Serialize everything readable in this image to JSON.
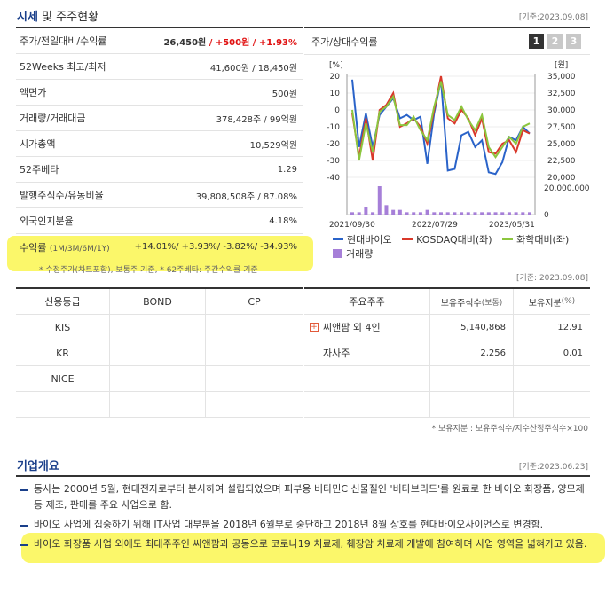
{
  "header": {
    "title_main": "시세",
    "title_rest": " 및 주주현황",
    "base_date": "[기준:2023.09.08]"
  },
  "summary": {
    "rows": [
      {
        "label": "주가/전일대비/수익률",
        "value_a": "26,450원",
        "value_b": " / +500원",
        "value_c": " / +1.93%"
      },
      {
        "label": "52Weeks 최고/최저",
        "value": "41,600원 / 18,450원"
      },
      {
        "label": "액면가",
        "value": "500원"
      },
      {
        "label": "거래량/거래대금",
        "value": "378,428주 / 99억원"
      },
      {
        "label": "시가총액",
        "value": "10,529억원"
      },
      {
        "label": "52주베타",
        "value": "1.29"
      },
      {
        "label": "발행주식수/유동비율",
        "value": "39,808,508주 / 87.08%"
      },
      {
        "label": "외국인지분율",
        "value": "4.18%"
      }
    ],
    "return_label": "수익률",
    "return_sub": "(1M/3M/6M/1Y)",
    "return_value": "+14.01%/ +3.93%/ -3.82%/ -34.93%",
    "note": "* 수정주가(차트포함), 보통주 기준, * 62주베타: 주간수익률 기준"
  },
  "chart_panel": {
    "title": "주가/상대수익률",
    "tabs": [
      "1",
      "2",
      "3"
    ],
    "active_tab": 0
  },
  "chart_data": {
    "type": "line",
    "left_axis_unit": "[%]",
    "right_axis_unit": "[원]",
    "left_ticks": [
      "20",
      "10",
      "0",
      "-10",
      "-20",
      "-30",
      "-40"
    ],
    "right_ticks": [
      "35,000",
      "32,500",
      "30,000",
      "27,500",
      "25,000",
      "22,500",
      "20,000"
    ],
    "volume_tick": "20,000,000",
    "volume_zero": "0",
    "x_labels": [
      "2021/09/30",
      "2022/07/29",
      "2023/05/31"
    ],
    "ylim_left": [
      -40,
      20
    ],
    "series": [
      {
        "name": "현대바이오",
        "color": "#2a63c9",
        "values": [
          18,
          -22,
          -2,
          -22,
          -3,
          2,
          7,
          -5,
          -3,
          -6,
          -4,
          -32,
          -2,
          18,
          -36,
          -35,
          -15,
          -13,
          -22,
          -18,
          -37,
          -38,
          -31,
          -16,
          -18,
          -10,
          -14
        ]
      },
      {
        "name": "KOSDAQ대비(좌)",
        "color": "#d9382a",
        "values": [
          -2,
          -28,
          -5,
          -30,
          0,
          3,
          10,
          -10,
          -8,
          -5,
          -10,
          -20,
          0,
          20,
          -5,
          -8,
          0,
          -5,
          -15,
          -5,
          -25,
          -26,
          -20,
          -18,
          -25,
          -12,
          -14
        ]
      },
      {
        "name": "화학대비(좌)",
        "color": "#8cc63e",
        "values": [
          0,
          -30,
          -8,
          -25,
          -1,
          2,
          8,
          -9,
          -9,
          -4,
          -12,
          -18,
          2,
          17,
          -3,
          -6,
          2,
          -6,
          -12,
          -3,
          -22,
          -28,
          -22,
          -16,
          -20,
          -10,
          -8
        ]
      }
    ],
    "volume": {
      "name": "거래량",
      "color": "#a67fd8",
      "values": [
        1,
        1,
        3,
        1,
        12,
        4,
        2,
        2,
        1,
        1,
        1,
        2,
        1,
        1,
        1,
        1,
        1,
        1,
        1,
        1,
        1,
        1,
        1,
        1,
        1,
        1,
        1
      ]
    }
  },
  "legend": [
    {
      "label": "현대바이오",
      "type": "line",
      "color": "#2a63c9"
    },
    {
      "label": "KOSDAQ대비(좌)",
      "type": "line",
      "color": "#d9382a"
    },
    {
      "label": "화학대비(좌)",
      "type": "line",
      "color": "#8cc63e"
    },
    {
      "label": "거래량",
      "type": "box",
      "color": "#a67fd8"
    }
  ],
  "holders_base_date": "[기준: 2023.09.08]",
  "credit": {
    "headers": [
      "신용등급",
      "BOND",
      "CP"
    ],
    "rows": [
      "KIS",
      "KR",
      "NICE"
    ]
  },
  "holders": {
    "header_1": "주요주주",
    "header_2": "보유주식수",
    "header_2_sub": "(보통)",
    "header_3": "보유지분",
    "header_3_sub": "(%)",
    "rows": [
      {
        "name": "씨앤팜 외 4인",
        "shares": "5,140,868",
        "pct": "12.91"
      },
      {
        "name": "자사주",
        "shares": "2,256",
        "pct": "0.01"
      }
    ],
    "note": "* 보유지분 : 보유주식수/지수산정주식수×100"
  },
  "company": {
    "title": "기업개요",
    "base_date": "[기준:2023.06.23]",
    "items": [
      "동사는 2000년 5월, 현대전자로부터 분사하여 설립되었으며 피부용 비타민C 신물질인 '비타브리드'를 원료로 한 바이오 화장품, 양모제 등 제조, 판매를 주요 사업으로 함.",
      "바이오 사업에 집중하기 위해 IT사업 대부분을 2018년 6월부로 중단하고 2018년 8월 상호를 현대바이오사이언스로 변경함.",
      "바이오 화장품 사업 외에도 최대주주인 씨앤팜과 공동으로 코로나19 치료제, 췌장암 치료제 개발에 참여하며 사업 영역을 넓혀가고 있음."
    ]
  }
}
